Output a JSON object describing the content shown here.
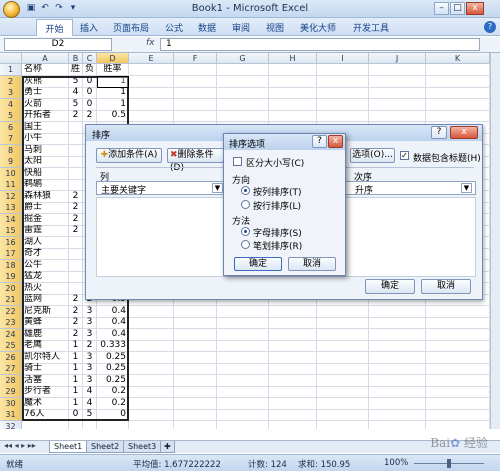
{
  "app": {
    "title": "Book1 - Microsoft Excel",
    "window_controls": [
      "–",
      "□",
      "x"
    ]
  },
  "ribbon": {
    "tabs": [
      "开始",
      "插入",
      "页面布局",
      "公式",
      "数据",
      "审阅",
      "视图",
      "美化大师",
      "开发工具"
    ]
  },
  "formula_bar": {
    "name_box": "D2",
    "fx": "fx",
    "value": "1"
  },
  "grid": {
    "columns": [
      "A",
      "B",
      "C",
      "D",
      "E",
      "F",
      "G",
      "H",
      "I",
      "J",
      "K"
    ],
    "selected_column": "D",
    "rows": [
      {
        "n": "1",
        "a": "名称",
        "b": "胜",
        "c": "负",
        "d": "胜率"
      },
      {
        "n": "2",
        "a": "灰熊",
        "b": "5",
        "c": "0",
        "d": "1"
      },
      {
        "n": "3",
        "a": "勇士",
        "b": "4",
        "c": "0",
        "d": "1"
      },
      {
        "n": "4",
        "a": "火箭",
        "b": "5",
        "c": "0",
        "d": "1"
      },
      {
        "n": "5",
        "a": "开拓者",
        "b": "2",
        "c": "2",
        "d": "0.5"
      },
      {
        "n": "6",
        "a": "国王",
        "b": "",
        "c": "",
        "d": ""
      },
      {
        "n": "7",
        "a": "小牛",
        "b": "",
        "c": "",
        "d": ""
      },
      {
        "n": "8",
        "a": "马刺",
        "b": "",
        "c": "",
        "d": ""
      },
      {
        "n": "9",
        "a": "太阳",
        "b": "",
        "c": "",
        "d": ""
      },
      {
        "n": "10",
        "a": "快船",
        "b": "",
        "c": "",
        "d": ""
      },
      {
        "n": "11",
        "a": "鹈鹕",
        "b": "",
        "c": "",
        "d": ""
      },
      {
        "n": "12",
        "a": "森林狼",
        "b": "2",
        "c": "",
        "d": ""
      },
      {
        "n": "13",
        "a": "爵士",
        "b": "2",
        "c": "",
        "d": ""
      },
      {
        "n": "14",
        "a": "掘金",
        "b": "2",
        "c": "",
        "d": ""
      },
      {
        "n": "15",
        "a": "雷霆",
        "b": "2",
        "c": "",
        "d": ""
      },
      {
        "n": "16",
        "a": "湖人",
        "b": "",
        "c": "",
        "d": ""
      },
      {
        "n": "17",
        "a": "奇才",
        "b": "",
        "c": "",
        "d": ""
      },
      {
        "n": "18",
        "a": "公牛",
        "b": "",
        "c": "",
        "d": ""
      },
      {
        "n": "19",
        "a": "猛龙",
        "b": "",
        "c": "",
        "d": ""
      },
      {
        "n": "20",
        "a": "热火",
        "b": "",
        "c": "",
        "d": ""
      },
      {
        "n": "21",
        "a": "篮网",
        "b": "2",
        "c": "2",
        "d": "0.5"
      },
      {
        "n": "22",
        "a": "尼克斯",
        "b": "2",
        "c": "3",
        "d": "0.4"
      },
      {
        "n": "23",
        "a": "黄蜂",
        "b": "2",
        "c": "3",
        "d": "0.4"
      },
      {
        "n": "24",
        "a": "雄鹿",
        "b": "2",
        "c": "3",
        "d": "0.4"
      },
      {
        "n": "25",
        "a": "老鹰",
        "b": "1",
        "c": "2",
        "d": "0.333"
      },
      {
        "n": "26",
        "a": "凯尔特人",
        "b": "1",
        "c": "3",
        "d": "0.25"
      },
      {
        "n": "27",
        "a": "骑士",
        "b": "1",
        "c": "3",
        "d": "0.25"
      },
      {
        "n": "28",
        "a": "活塞",
        "b": "1",
        "c": "3",
        "d": "0.25"
      },
      {
        "n": "29",
        "a": "步行者",
        "b": "1",
        "c": "4",
        "d": "0.2"
      },
      {
        "n": "30",
        "a": "魔术",
        "b": "1",
        "c": "4",
        "d": "0.2"
      },
      {
        "n": "31",
        "a": "76人",
        "b": "0",
        "c": "5",
        "d": "0"
      },
      {
        "n": "32",
        "a": "",
        "b": "",
        "c": "",
        "d": ""
      }
    ]
  },
  "sheets": [
    "Sheet1",
    "Sheet2",
    "Sheet3"
  ],
  "status": {
    "mode": "就绪",
    "average": "平均值: 1.677222222",
    "count": "计数: 124",
    "sum": "求和: 150.95",
    "zoom": "100%"
  },
  "sort_dialog": {
    "title": "排序",
    "add_label": "添加条件(A)",
    "delete_label": "删除条件(D)",
    "options_label": "选项(O)...",
    "header_check_label": "数据包含标题(H)",
    "header_checked": true,
    "column_header": "列",
    "order_header": "次序",
    "primary_key_label": "主要关键字",
    "order_value": "升序",
    "ok_label": "确定",
    "cancel_label": "取消"
  },
  "options_dialog": {
    "title": "排序选项",
    "case_label": "区分大小写(C)",
    "case_checked": false,
    "direction_label": "方向",
    "direction_options": [
      "按列排序(T)",
      "按行排序(L)"
    ],
    "direction_selected": 0,
    "method_label": "方法",
    "method_options": [
      "字母排序(S)",
      "笔划排序(R)"
    ],
    "method_selected": 0,
    "ok_label": "确定",
    "cancel_label": "取消"
  },
  "watermark": "Bai 经验"
}
